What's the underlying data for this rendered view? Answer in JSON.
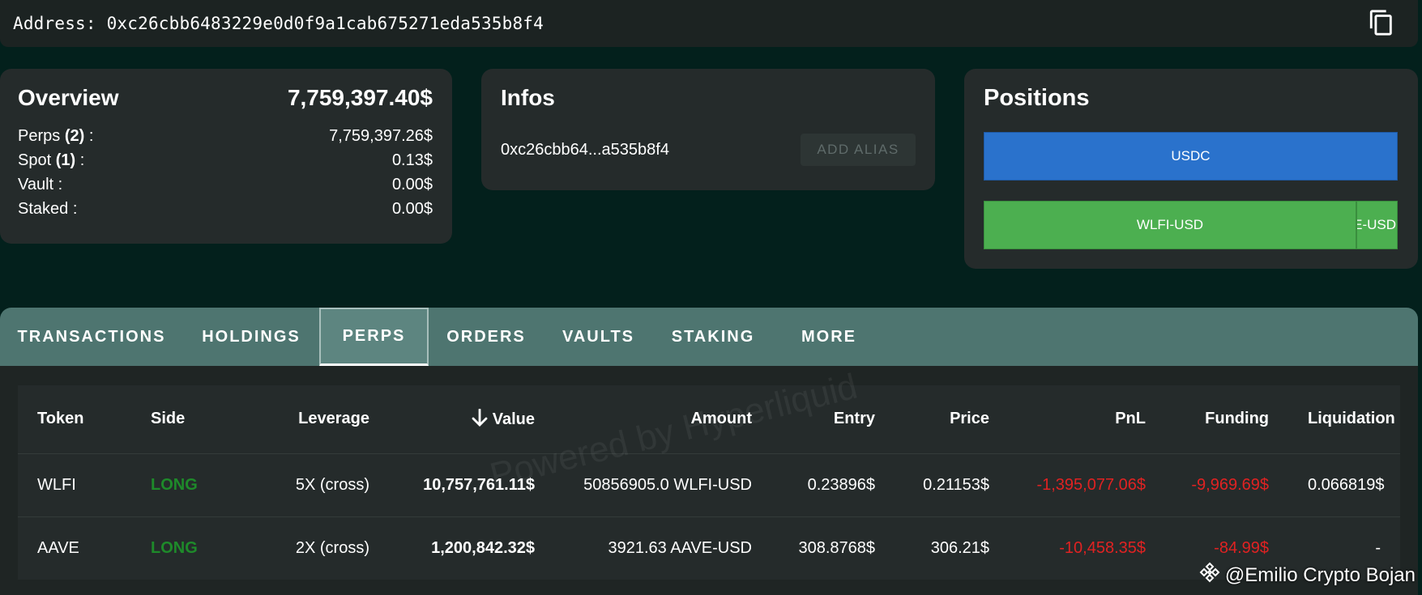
{
  "address_bar": {
    "label": "Address: 0xc26cbb6483229e0d0f9a1cab675271eda535b8f4"
  },
  "overview": {
    "title": "Overview",
    "total": "7,759,397.40$",
    "rows": [
      {
        "label_pre": "Perps ",
        "count": "(2)",
        "label_post": " :",
        "value": "7,759,397.26$"
      },
      {
        "label_pre": "Spot ",
        "count": "(1)",
        "label_post": " :",
        "value": "0.13$"
      },
      {
        "label_pre": "Vault :",
        "count": "",
        "label_post": "",
        "value": "0.00$"
      },
      {
        "label_pre": "Staked :",
        "count": "",
        "label_post": "",
        "value": "0.00$"
      }
    ]
  },
  "infos": {
    "title": "Infos",
    "short_address": "0xc26cbb64...a535b8f4",
    "add_alias_label": "ADD ALIAS"
  },
  "positions": {
    "title": "Positions",
    "bars": [
      {
        "label": "USDC",
        "color": "#2a72cc"
      },
      {
        "label": "WLFI-USD",
        "color": "#4caf50"
      },
      {
        "label": "AAVE-USD",
        "color": "#4caf50"
      }
    ]
  },
  "tabs": [
    {
      "label": "TRANSACTIONS"
    },
    {
      "label": "HOLDINGS"
    },
    {
      "label": "PERPS",
      "active": true
    },
    {
      "label": "ORDERS"
    },
    {
      "label": "VAULTS"
    },
    {
      "label": "STAKING"
    },
    {
      "label": "MORE"
    }
  ],
  "perps_table": {
    "columns": [
      "Token",
      "Side",
      "Leverage",
      "Value",
      "Amount",
      "Entry",
      "Price",
      "PnL",
      "Funding",
      "Liquidation"
    ],
    "sort_column": "Value",
    "rows": [
      {
        "token": "WLFI",
        "side": "LONG",
        "leverage": "5X (cross)",
        "value": "10,757,761.11$",
        "amount": "50856905.0 WLFI-USD",
        "entry": "0.23896$",
        "price": "0.21153$",
        "pnl": "-1,395,077.06$",
        "funding": "-9,969.69$",
        "liquidation": "0.066819$"
      },
      {
        "token": "AAVE",
        "side": "LONG",
        "leverage": "2X (cross)",
        "value": "1,200,842.32$",
        "amount": "3921.63 AAVE-USD",
        "entry": "308.8768$",
        "price": "306.21$",
        "pnl": "-10,458.35$",
        "funding": "-84.99$",
        "liquidation": "-"
      }
    ]
  },
  "watermark": "Powered by Hyperliquid",
  "credit": "@Emilio Crypto Bojan",
  "colors": {
    "long": "#1e8a2a",
    "negative": "#e02222",
    "tab_bar": "#4e7570"
  }
}
